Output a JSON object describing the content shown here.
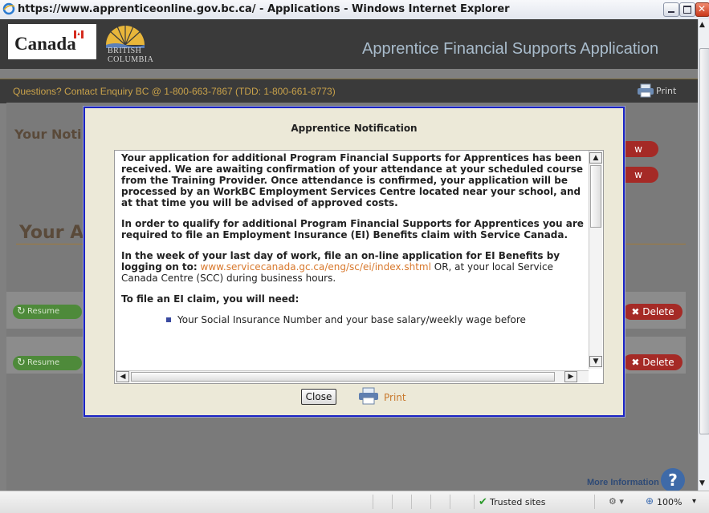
{
  "browser": {
    "window_title": "https://www.apprenticeonline.gov.bc.ca/ - Applications - Windows Internet Explorer",
    "status": {
      "zone": "Trusted sites",
      "zoom": "100%"
    }
  },
  "header": {
    "canada_word": "Canada",
    "bc_line1": "BRITISH",
    "bc_line2": "COLUMBIA",
    "app_title": "Apprentice Financial Supports Application",
    "contact": "Questions? Contact Enquiry BC @ 1-800-663-7867 (TDD: 1-800-661-8773)",
    "print_label": "Print"
  },
  "background": {
    "notices_heading": "Your Noti",
    "applications_heading": "Your A",
    "view_label_1": "w",
    "view_label_2": "w",
    "resume_label": "Resume",
    "delete_label": "Delete",
    "more_info": "More Information",
    "help_glyph": "?"
  },
  "modal": {
    "title": "Apprentice Notification",
    "para1": "Your application for additional Program Financial Supports for Apprentices has been received. We are awaiting confirmation of your attendance at your scheduled course from the Training Provider. Once attendance is confirmed, your application will be processed by an WorkBC Employment Services Centre located near your school, and at that time you will be advised of approved costs.",
    "para2": "In order to qualify for additional Program Financial Supports for Apprentices you are required to file an Employment Insurance (EI) Benefits claim with Service Canada.",
    "para3_bold": "In the week of your last day of work, file an on-line application for EI Benefits by logging on to:",
    "para3_link": "www.servicecanada.gc.ca/eng/sc/ei/index.shtml",
    "para3_rest": "OR, at your local Service Canada Centre (SCC) during business hours.",
    "para4": "To file an EI claim, you will need:",
    "bullet1": "Your Social Insurance Number and your base salary/weekly wage before",
    "close_label": "Close",
    "print_label": "Print"
  },
  "colors": {
    "modal_border": "#1b24c4",
    "link": "#d8782c",
    "delete": "#a52a26",
    "resume": "#4e8a3a"
  }
}
